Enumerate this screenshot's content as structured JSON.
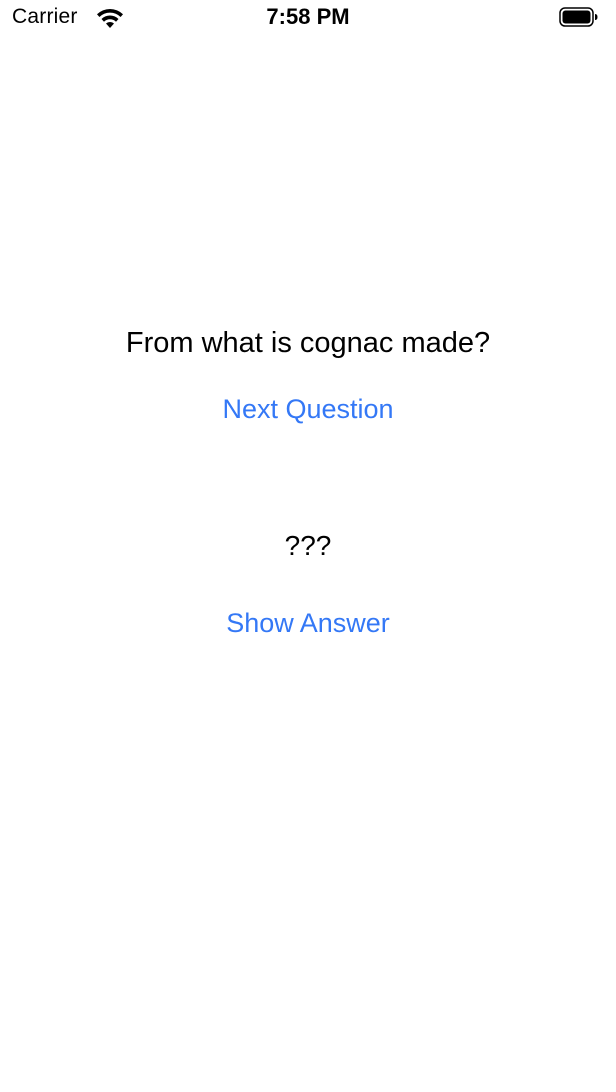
{
  "status_bar": {
    "carrier": "Carrier",
    "time": "7:58 PM",
    "icons": [
      "wifi-icon",
      "battery-icon"
    ]
  },
  "quiz": {
    "question": "From what is cognac made?",
    "next_button_label": "Next Question",
    "answer": "???",
    "show_answer_button_label": "Show Answer"
  },
  "colors": {
    "accent": "#3478f6",
    "text": "#000000",
    "background": "#ffffff"
  }
}
